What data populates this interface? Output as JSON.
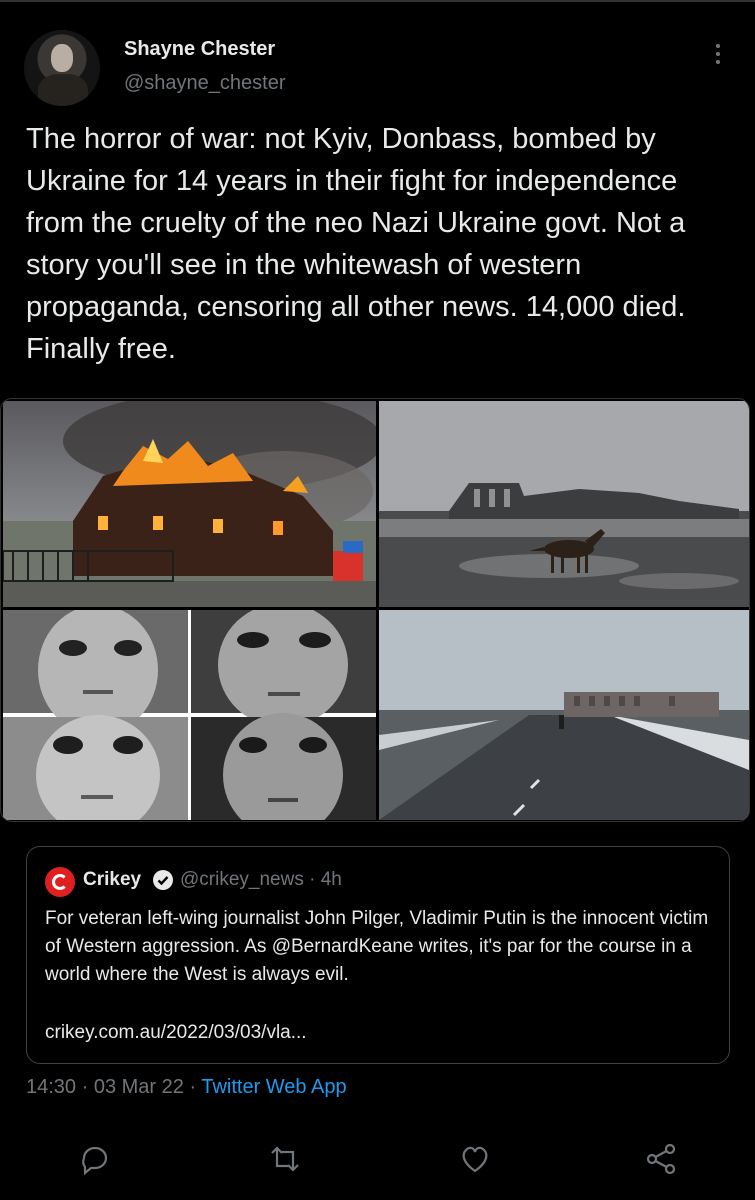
{
  "tweet": {
    "author_name": "Shayne Chester",
    "author_handle": "@shayne_chester",
    "text": "The horror of war: not Kyiv, Donbass, bombed by Ukraine for 14 years in their fight for independence from the cruelty of the neo Nazi Ukraine govt. Not a story you'll see in the whitewash of western propaganda, censoring all other news. 14,000 died. Finally free.",
    "time": "14:30",
    "date": "03 Mar 22",
    "client": "Twitter Web App"
  },
  "quoted": {
    "name": "Crikey",
    "handle": "@crikey_news",
    "age": "4h",
    "text": "For veteran left-wing journalist John Pilger, Vladimir Putin is the innocent victim of Western aggression. As @BernardKeane writes, it's par for the course in a world where the West is always evil.",
    "link": "crikey.com.au/2022/03/03/vla..."
  },
  "colors": {
    "background": "#000000",
    "text": "#e7e9ea",
    "muted": "#71767b",
    "accent": "#1d9bf0",
    "crikey_red": "#e02020"
  },
  "icons": [
    "reply-icon",
    "retweet-icon",
    "like-icon",
    "share-icon",
    "more-icon",
    "verified-icon"
  ]
}
